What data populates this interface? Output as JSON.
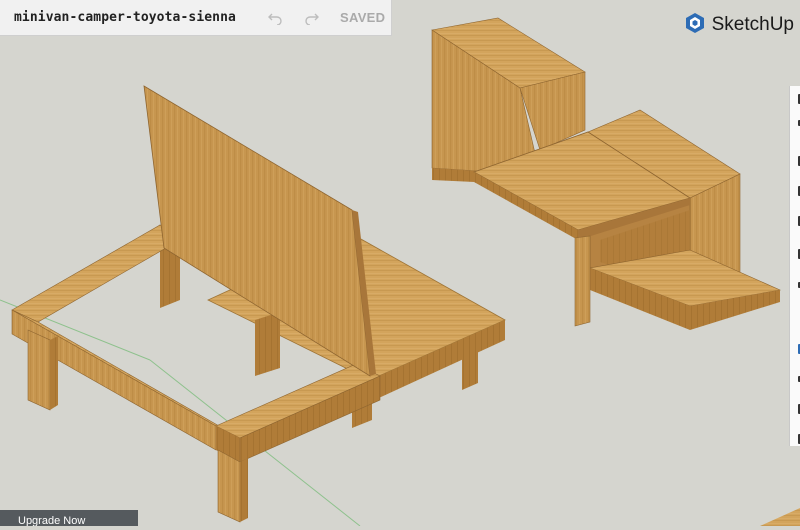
{
  "header": {
    "model_name": "minivan-camper-toyota-sienna",
    "saved_label": "SAVED",
    "undo_icon": "undo-icon",
    "redo_icon": "redo-icon"
  },
  "brand": {
    "name": "SketchUp",
    "logo_icon": "sketchup-logo-icon",
    "logo_color": "#2d6cb5"
  },
  "footer": {
    "upgrade_label": "Upgrade Now"
  },
  "canvas": {
    "background_color": "#d5d5cf",
    "wood_color": "#c89a52"
  }
}
